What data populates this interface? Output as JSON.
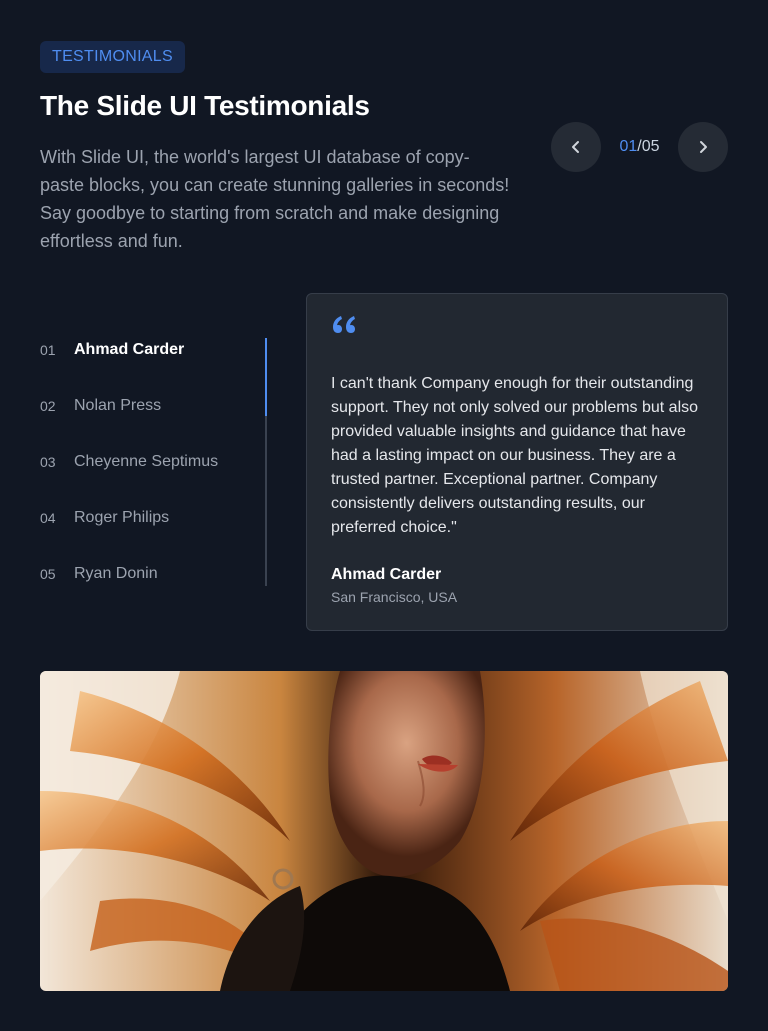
{
  "header": {
    "badge": "TESTIMONIALS",
    "title": "The Slide UI Testimonials",
    "description": "With Slide UI, the world's largest UI database of copy-paste blocks, you can create stunning galleries in seconds! Say goodbye to starting from scratch and make designing effortless and fun."
  },
  "pagination": {
    "current": "01",
    "separator": "/",
    "total": "05",
    "prev_icon": "chevron-left-icon",
    "next_icon": "chevron-right-icon"
  },
  "testimonials": [
    {
      "number": "01",
      "name": "Ahmad Carder",
      "active": true
    },
    {
      "number": "02",
      "name": "Nolan Press",
      "active": false
    },
    {
      "number": "03",
      "name": "Cheyenne Septimus",
      "active": false
    },
    {
      "number": "04",
      "name": "Roger Philips",
      "active": false
    },
    {
      "number": "05",
      "name": "Ryan Donin",
      "active": false
    }
  ],
  "card": {
    "quote_icon": "quote-icon",
    "quote": "I can't thank Company enough for their outstanding support. They not only solved our problems but also provided valuable insights and guidance that have had a lasting impact on our business. They are a trusted partner. Exceptional partner. Company consistently delivers outstanding results, our preferred choice.\"",
    "author": "Ahmad Carder",
    "location": "San Francisco, USA"
  },
  "colors": {
    "background": "#111723",
    "accent": "#4f8df0",
    "card": "#222831"
  }
}
